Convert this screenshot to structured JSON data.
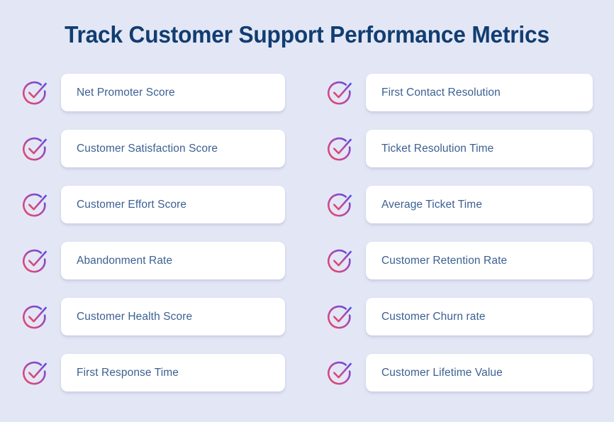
{
  "page": {
    "background_color": "#e3e7f5",
    "title": "Track Customer Support Performance Metrics",
    "title_color": "#113d71"
  },
  "icon": {
    "name": "circle-check-icon",
    "gradient_start": "#ec4863",
    "gradient_mid": "#b44aa8",
    "gradient_end": "#5b4ae8"
  },
  "card": {
    "background_color": "#ffffff",
    "label_color": "#3c6092"
  },
  "columns": {
    "left": {
      "items": [
        {
          "label": "Net Promoter Score"
        },
        {
          "label": "Customer Satisfaction Score"
        },
        {
          "label": "Customer Effort Score"
        },
        {
          "label": "Abandonment Rate"
        },
        {
          "label": "Customer Health Score"
        },
        {
          "label": "First Response Time"
        }
      ]
    },
    "right": {
      "items": [
        {
          "label": "First Contact Resolution"
        },
        {
          "label": "Ticket Resolution Time"
        },
        {
          "label": "Average Ticket Time"
        },
        {
          "label": "Customer Retention Rate"
        },
        {
          "label": "Customer Churn rate"
        },
        {
          "label": "Customer Lifetime Value"
        }
      ]
    }
  }
}
